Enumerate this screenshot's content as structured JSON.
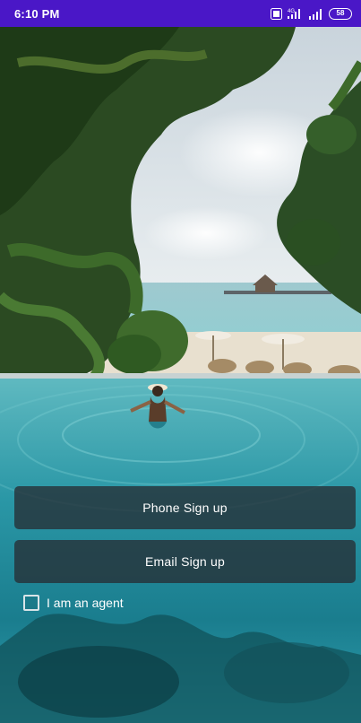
{
  "status_bar": {
    "time": "6:10 PM",
    "network": "4G",
    "battery": "58",
    "background_color": "#4a17c7"
  },
  "actions": {
    "phone_signup_label": "Phone Sign up",
    "email_signup_label": "Email Sign up"
  },
  "agent_option": {
    "label": "I am an agent",
    "checked": false
  },
  "icons": [
    "hd-icon",
    "signal-4g-icon",
    "signal-icon",
    "battery-icon"
  ]
}
